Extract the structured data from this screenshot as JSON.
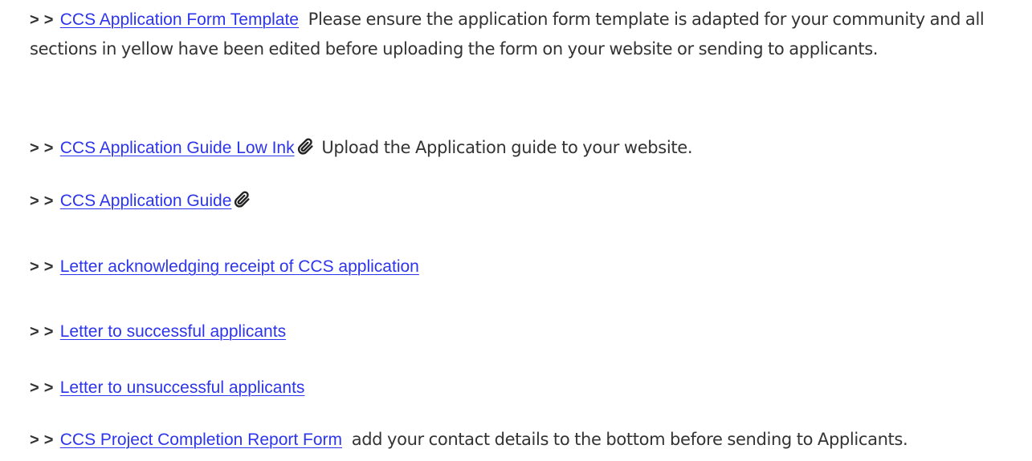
{
  "items": [
    {
      "prefix": "> >",
      "link": "CCS Application Form Template",
      "description": "Please ensure the application form template is adapted for your community and all sections in yellow have been edited before uploading the form on your website or sending to applicants."
    },
    {
      "prefix": "> >",
      "link": "CCS Application Guide Low Ink",
      "icon": "paperclip-icon",
      "description": "Upload the Application guide to your website."
    },
    {
      "prefix": "> >",
      "link": "CCS Application Guide",
      "icon": "paperclip-icon"
    },
    {
      "prefix": "> >",
      "link": "Letter acknowledging receipt of CCS application"
    },
    {
      "prefix": "> >",
      "link": "Letter to successful applicants"
    },
    {
      "prefix": "> >",
      "link": "Letter to unsuccessful applicants"
    },
    {
      "prefix": "> >",
      "link": "CCS Project Completion Report Form",
      "description": "add your contact details to the bottom before sending to Applicants."
    }
  ],
  "colors": {
    "link": "#2c35ec",
    "text": "#333333",
    "background": "#ffffff"
  }
}
